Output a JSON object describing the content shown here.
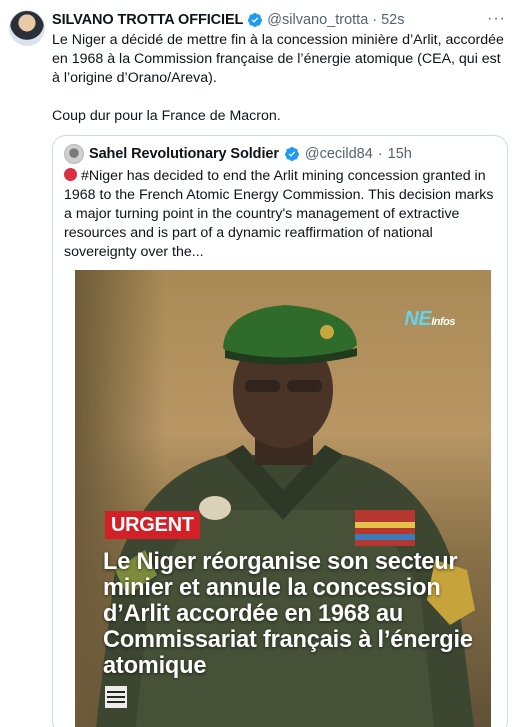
{
  "tweet": {
    "author_name": "SILVANO TROTTA OFFICIEL",
    "handle": "@silvano_trotta",
    "separator": "·",
    "time": "52s",
    "text_p1": "Le Niger a décidé de mettre fin à la concession minière d’Arlit, accordée en 1968 à la Commission française de l’énergie atomique (CEA, qui est à l’origine d’Orano/Areva).",
    "text_p2": "Coup dur pour la France de Macron.",
    "more_label": "···"
  },
  "quoted": {
    "author_name": "Sahel Revolutionary Soldier",
    "handle": "@cecild84",
    "separator": "·",
    "time": "15h",
    "text": "#Niger has decided to end the Arlit mining concession granted in 1968 to the French Atomic Energy Commission. This decision marks a major turning point in the country's management of extractive resources and is part of a dynamic reaffirmation of national sovereignty over the...",
    "media": {
      "logo_main": "NE",
      "logo_sub": "Infos",
      "badge": "URGENT",
      "headline": "Le Niger réorganise son secteur minier et annule la concession d’Arlit accordée en 1968 au Commissariat français à l’énergie atomique"
    }
  },
  "colors": {
    "verified": "#1d9bf0",
    "muted": "#536471",
    "urgent": "#d32027",
    "logo": "#62d3f0"
  },
  "icons": [
    "verified-badge-icon",
    "more-icon",
    "red-circle-icon",
    "qr-code-icon"
  ]
}
